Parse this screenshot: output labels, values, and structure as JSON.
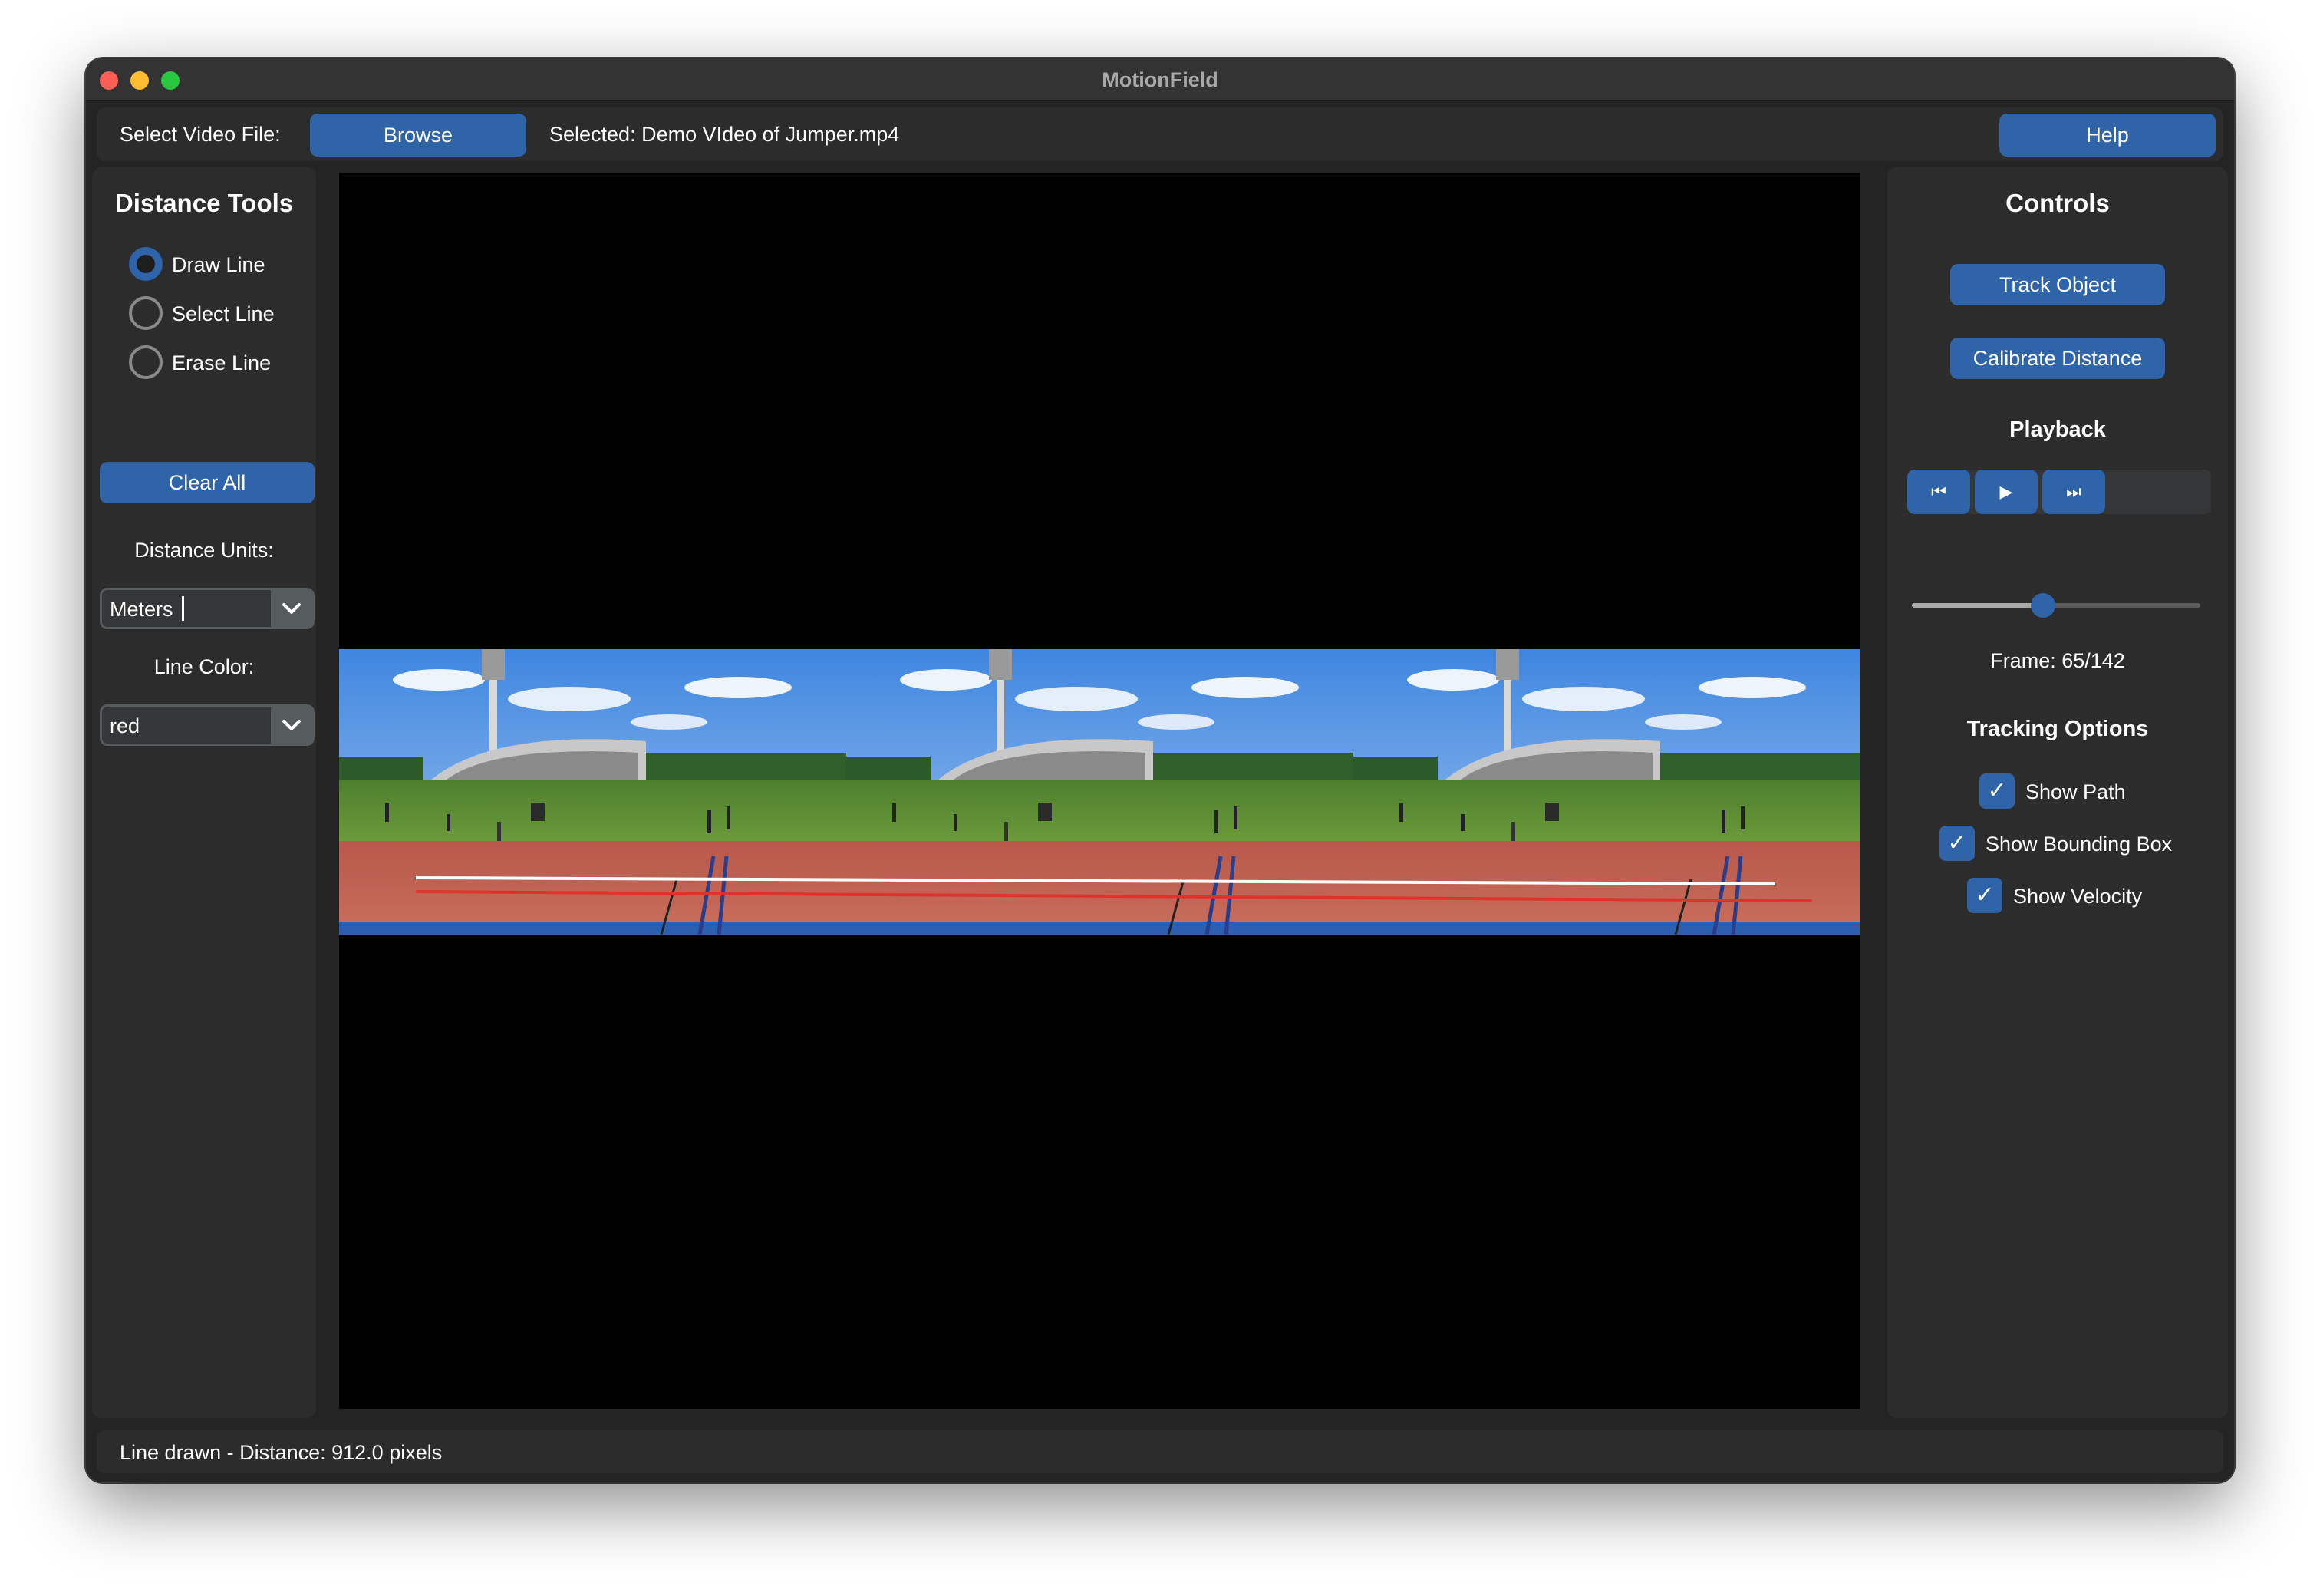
{
  "window": {
    "title": "MotionField"
  },
  "topbar": {
    "select_label": "Select Video File:",
    "browse_label": "Browse",
    "selected_text": "Selected: Demo VIdeo of Jumper.mp4",
    "help_label": "Help"
  },
  "distance_tools": {
    "title": "Distance Tools",
    "modes": [
      {
        "label": "Draw Line",
        "selected": true
      },
      {
        "label": "Select Line",
        "selected": false
      },
      {
        "label": "Erase Line",
        "selected": false
      }
    ],
    "clear_label": "Clear All",
    "units_label": "Distance Units:",
    "units_value": "Meters",
    "color_label": "Line Color:",
    "color_value": "red"
  },
  "controls": {
    "title": "Controls",
    "track_label": "Track Object",
    "calibrate_label": "Calibrate Distance",
    "playback_title": "Playback",
    "rewind_icon": "⏮",
    "play_icon": "▶",
    "forward_icon": "⏭",
    "frame_current": 65,
    "frame_total": 142,
    "frame_text": "Frame: 65/142",
    "tracking_title": "Tracking Options",
    "options": [
      {
        "label": "Show Path",
        "checked": true
      },
      {
        "label": "Show Bounding Box",
        "checked": true
      },
      {
        "label": "Show Velocity",
        "checked": true
      }
    ]
  },
  "status": {
    "text": "Line drawn - Distance: 912.0 pixels"
  },
  "colors": {
    "accent": "#2f64a8",
    "panel": "#2c2c2c",
    "window": "#242424",
    "line_red": "#e0322d",
    "line_white": "#ffffff"
  }
}
